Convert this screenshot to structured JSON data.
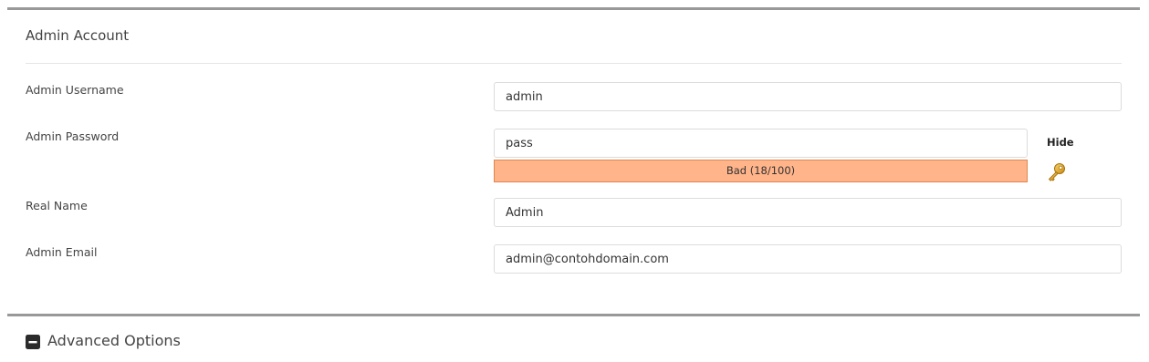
{
  "admin_account": {
    "title": "Admin Account",
    "username": {
      "label": "Admin Username",
      "value": "admin"
    },
    "password": {
      "label": "Admin Password",
      "value": "pass",
      "strength_text": "Bad (18/100)",
      "strength_score": 18,
      "strength_color": "#ffb48a",
      "toggle_label": "Hide",
      "generator_icon": "key-icon"
    },
    "real_name": {
      "label": "Real Name",
      "value": "Admin"
    },
    "email": {
      "label": "Admin Email",
      "value": "admin@contohdomain.com"
    }
  },
  "advanced_options": {
    "title": "Advanced Options",
    "icon": "collapse-minus-icon"
  }
}
